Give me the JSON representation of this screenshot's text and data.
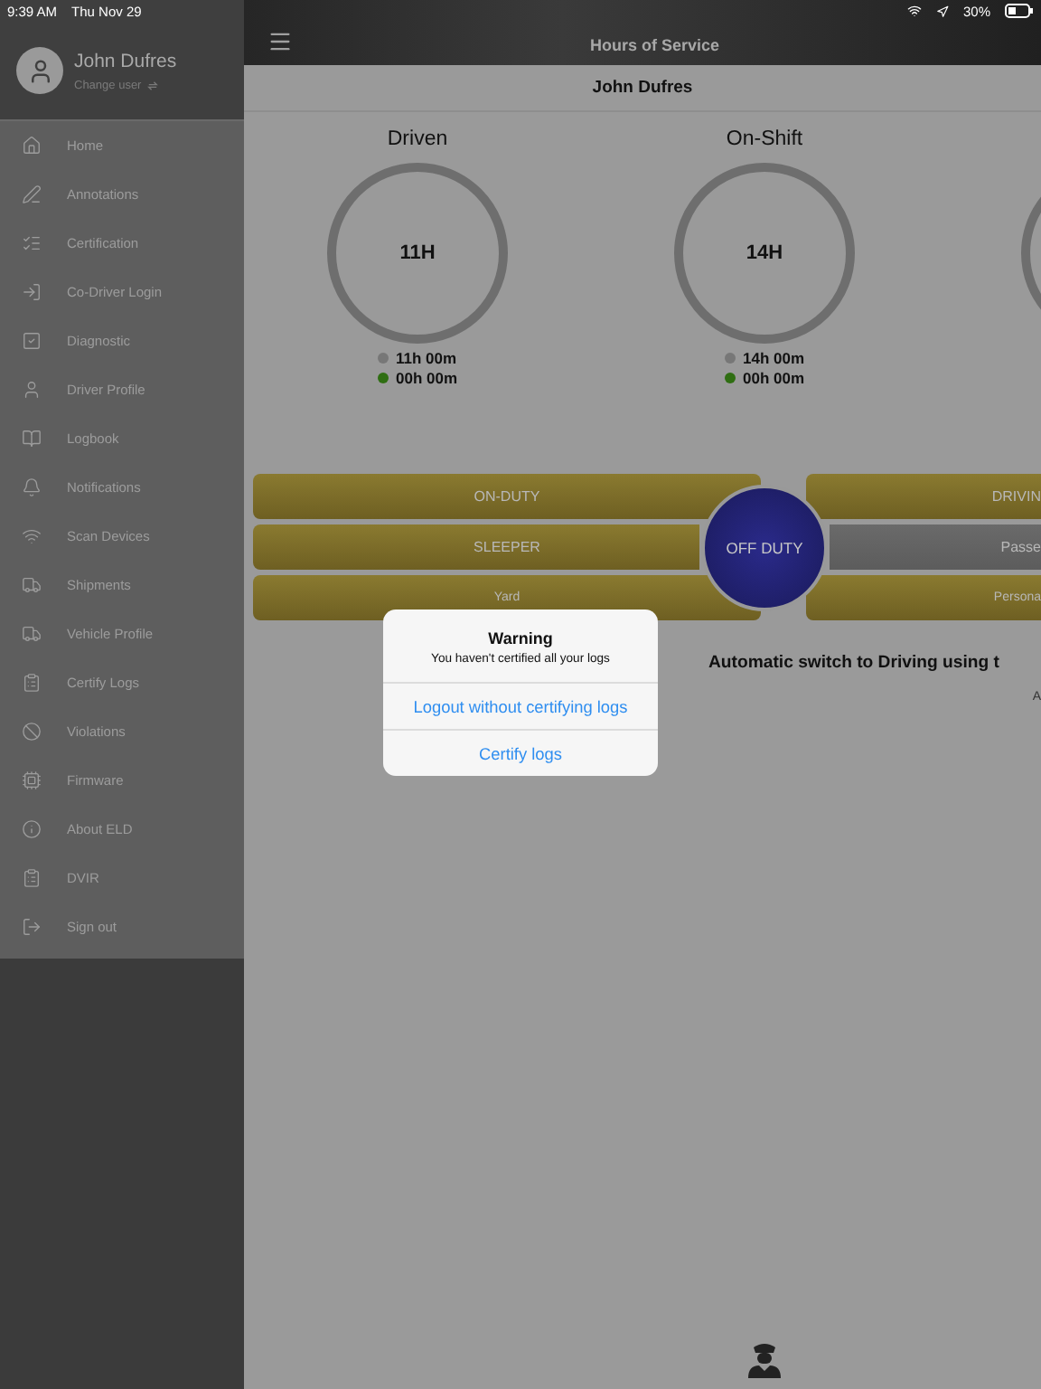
{
  "status_bar": {
    "time": "9:39 AM",
    "date": "Thu Nov 29",
    "battery": "30%"
  },
  "sidebar": {
    "user": {
      "name": "John Dufres",
      "action": "Change user"
    },
    "items": [
      {
        "label": "Home"
      },
      {
        "label": "Annotations"
      },
      {
        "label": "Certification"
      },
      {
        "label": "Co-Driver Login"
      },
      {
        "label": "Diagnostic"
      },
      {
        "label": "Driver Profile"
      },
      {
        "label": "Logbook"
      },
      {
        "label": "Notifications"
      },
      {
        "label": "Scan Devices"
      },
      {
        "label": "Shipments"
      },
      {
        "label": "Vehicle Profile"
      },
      {
        "label": "Certify Logs"
      },
      {
        "label": "Violations"
      },
      {
        "label": "Firmware"
      },
      {
        "label": "About ELD"
      },
      {
        "label": "DVIR"
      },
      {
        "label": "Sign out"
      }
    ]
  },
  "header": {
    "title": "Hours of Service"
  },
  "driver_name": "John Dufres",
  "gauges": [
    {
      "title": "Driven",
      "value": "11H",
      "legend": [
        {
          "text": "11h 00m",
          "color": "#777777"
        },
        {
          "text": "00h 00m",
          "color": "#2f6e12"
        }
      ]
    },
    {
      "title": "On-Shift",
      "value": "14H",
      "legend": [
        {
          "text": "14h 00m",
          "color": "#777777"
        },
        {
          "text": "00h 00m",
          "color": "#2f6e12"
        }
      ]
    }
  ],
  "duty_statuses": [
    {
      "label": "ON-DUTY",
      "selected": false,
      "disabled": false
    },
    {
      "label": "DRIVIN",
      "selected": false,
      "disabled": false
    },
    {
      "label": "SLEEPER",
      "selected": false,
      "disabled": false
    },
    {
      "label": "Passe",
      "selected": false,
      "disabled": true
    },
    {
      "label": "Yard",
      "selected": false,
      "disabled": false
    },
    {
      "label": "Persona",
      "selected": false,
      "disabled": false
    }
  ],
  "off_duty": {
    "label": "OFF DUTY",
    "selected": true
  },
  "auto_switch": "Automatic switch to Driving using t",
  "cut_text": "A",
  "alert": {
    "title": "Warning",
    "message": "You haven't certified all your logs",
    "actions": [
      "Logout without certifying logs",
      "Certify logs"
    ]
  }
}
